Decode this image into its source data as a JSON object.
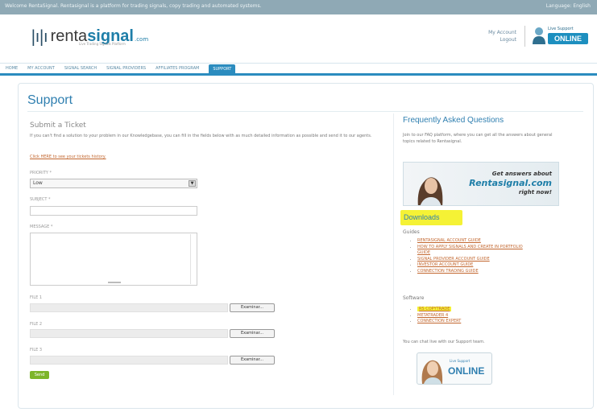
{
  "topbar": {
    "message": "Welcome RentaSignal. Rentasignal is a platform for trading signals, copy trading and automated systems.",
    "right": "Language: English"
  },
  "brand": {
    "mark": "|ı|ı",
    "name_prefix": "renta",
    "name_accent": "signal",
    "tld": ".com",
    "tagline": "Live Trading Signals Platform"
  },
  "account": {
    "my_account": "My Account",
    "logout": "Logout"
  },
  "live_support": {
    "label": "Live Support",
    "status": "ONLINE"
  },
  "nav": {
    "tabs": [
      {
        "label": "Home"
      },
      {
        "label": "My Account"
      },
      {
        "label": "Signal Search"
      },
      {
        "label": "Signal Providers"
      },
      {
        "label": "Affiliates Program"
      },
      {
        "label": "Support"
      }
    ],
    "active_index": 5
  },
  "page": {
    "title": "Support"
  },
  "ticket": {
    "heading": "Submit a Ticket",
    "intro": "If you can't find a solution to your problem in our Knowledgebase, you can fill in the fields below with as much detailed information as possible and send it to our agents.",
    "history_link": "Click HERE to see your tickets history.",
    "priority_label": "Priority *",
    "priority_value": "Low",
    "subject_label": "Subject *",
    "message_label": "Message *",
    "file_labels": [
      "File 1",
      "File 2",
      "File 3"
    ],
    "browse_label": "Examinar...",
    "send_label": "Send"
  },
  "faq": {
    "heading": "Frequently Asked Questions",
    "text": "Join to our FAQ platform, where you can get all the answers about general topics related to Rentasignal.",
    "banner_line1": "Get answers about",
    "banner_line2": "Rentasignal.com",
    "banner_line3": "right now!"
  },
  "downloads": {
    "heading": "Downloads",
    "guides_label": "Guides",
    "guides": [
      "Rentasignal account guide",
      "How to apply signals and create in portfolio",
      "Guide",
      "Signal provider account guide",
      "Investor account guide",
      "Connection trading guide"
    ],
    "software_label": "Software",
    "software": [
      "RS Copytrade",
      "Metatrader 4",
      "Connection Expert"
    ],
    "chat_text": "You can chat live with our Support team.",
    "chat_live": "Live Support",
    "chat_status": "ONLINE"
  },
  "colors": {
    "accent": "#2b8cbf",
    "link": "#c2662e",
    "highlight": "#f5f235",
    "send": "#7db52a"
  }
}
